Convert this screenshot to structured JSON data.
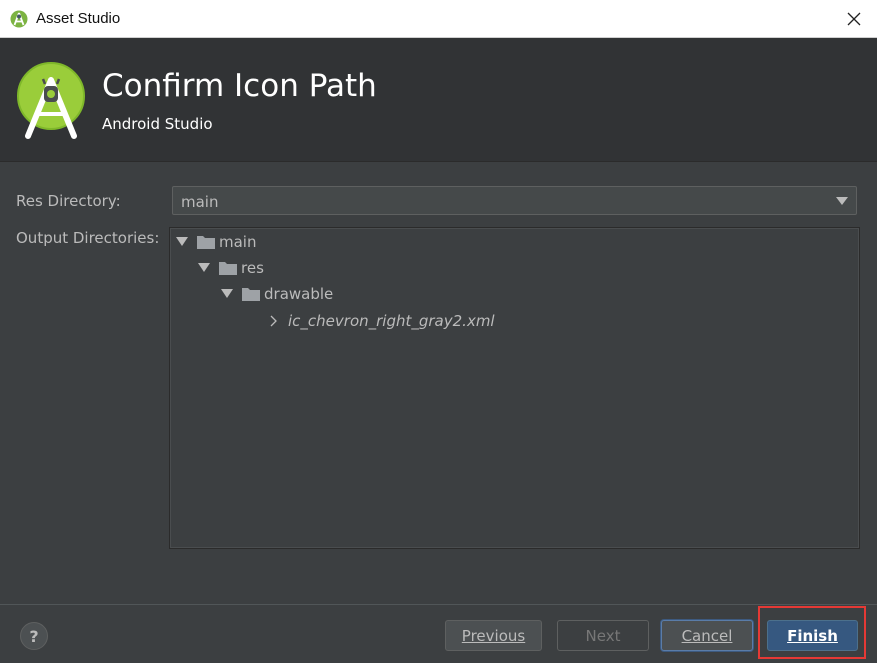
{
  "window": {
    "title": "Asset Studio",
    "app_icon": "android-studio-icon",
    "close_icon": "close-icon"
  },
  "header": {
    "title": "Confirm Icon Path",
    "subtitle": "Android Studio",
    "logo": "android-studio-logo"
  },
  "form": {
    "res_directory_label": "Res Directory:",
    "res_directory_value": "main",
    "output_directories_label": "Output Directories:"
  },
  "tree": {
    "nodes": [
      {
        "label": "main",
        "level": 0,
        "type": "folder",
        "expanded": true
      },
      {
        "label": "res",
        "level": 1,
        "type": "folder",
        "expanded": true
      },
      {
        "label": "drawable",
        "level": 2,
        "type": "folder",
        "expanded": true
      },
      {
        "label": "ic_chevron_right_gray2.xml",
        "level": 3,
        "type": "file",
        "expanded": false
      }
    ]
  },
  "footer": {
    "help_label": "?",
    "previous_label": "Previous",
    "next_label": "Next",
    "cancel_label": "Cancel",
    "finish_label": "Finish"
  },
  "colors": {
    "background": "#3c3f41",
    "header_bg": "#313335",
    "android_green": "#9acd3a",
    "finish_button": "#365880",
    "highlight": "#e53935"
  }
}
